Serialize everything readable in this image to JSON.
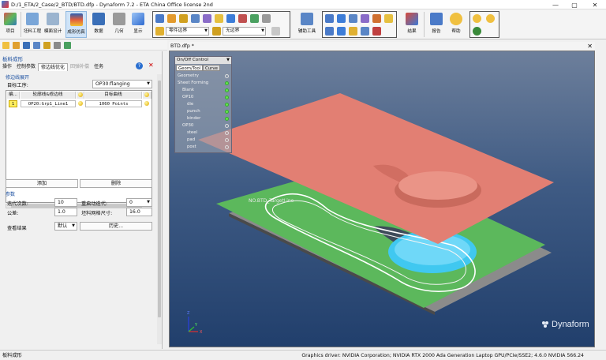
{
  "window": {
    "title": "D:/1_ETA/2_Case/2_BTD/BTD.dfp - Dynaform 7.2  -  ETA China Office license 2nd",
    "min": "—",
    "max": "▢",
    "close": "✕"
  },
  "ribbon": {
    "buttons": [
      {
        "label": "项目",
        "color": "#d9534f"
      },
      {
        "label": "坯料工程",
        "color": "#7aa6d8"
      },
      {
        "label": "模面设计",
        "color": "#9bb4cf"
      },
      {
        "label": "成形仿真",
        "color": "#e25c3c"
      },
      {
        "label": "数据",
        "color": "#3a6fb8"
      },
      {
        "label": "几何",
        "color": "#8a8a8a"
      },
      {
        "label": "显示",
        "color": "#3d7dd8"
      }
    ],
    "selects": [
      "零件边界",
      "无边界"
    ],
    "tools": [
      {
        "label": "辅助工具",
        "color": "#5a86c6"
      },
      {
        "label": "结果",
        "color": "#d84a3a"
      },
      {
        "label": "报告",
        "color": "#4a7ac8"
      },
      {
        "label": "帮助",
        "color": "#e0b030"
      }
    ]
  },
  "panel": {
    "title": "板料成形",
    "tabs": [
      {
        "label": "操作",
        "state": "normal"
      },
      {
        "label": "控制参数",
        "state": "normal"
      },
      {
        "label": "修边线优化",
        "state": "active"
      },
      {
        "label": "回弹补偿",
        "state": "disabled"
      },
      {
        "label": "任务",
        "state": "normal"
      }
    ],
    "help": "?",
    "close": "✕",
    "section1": "修边线展开",
    "target_label": "目标工序:",
    "target_value": "OP30:flanging",
    "table": {
      "headers": [
        "编...",
        "轮廓线&修边线",
        "",
        "目标曲线",
        ""
      ],
      "rows": [
        {
          "id": "1",
          "contour": "OP20:Grp1_Line1",
          "target": "1060 Points"
        }
      ]
    },
    "add": "添加",
    "delete": "删除",
    "section2": "参数",
    "iter_label": "迭代次数:",
    "iter_value": "10",
    "restart_label": "重启动迭代:",
    "restart_value": "0",
    "tol_label": "公差:",
    "tol_value": "1.0",
    "mesh_label": "坯料网格尺寸:",
    "mesh_value": "16.0",
    "view_label": "查看结果",
    "view_value": "默认",
    "history": "历史..."
  },
  "viewport": {
    "tab": "BTD.dfp *",
    "tab_close": "✕",
    "overlay_label": "NO.BTD_TargetLine",
    "brand": "Dynaform",
    "axis_x": "X",
    "axis_y": "Y",
    "axis_z": "Z",
    "tree": {
      "header": "On/Off Control",
      "tabs": [
        "Geom/Tool",
        "Curve"
      ],
      "nodes": [
        {
          "label": "Geometry",
          "indent": 0,
          "on": false
        },
        {
          "label": "Sheet Forming",
          "indent": 0,
          "on": true
        },
        {
          "label": "Blank",
          "indent": 1,
          "on": true
        },
        {
          "label": "OP10",
          "indent": 1,
          "on": true
        },
        {
          "label": "die",
          "indent": 2,
          "on": true
        },
        {
          "label": "punch",
          "indent": 2,
          "on": true
        },
        {
          "label": "binder",
          "indent": 2,
          "on": true
        },
        {
          "label": "OP30",
          "indent": 1,
          "on": false
        },
        {
          "label": "steel",
          "indent": 2,
          "on": false
        },
        {
          "label": "pad",
          "indent": 2,
          "on": false
        },
        {
          "label": "post",
          "indent": 2,
          "on": false
        }
      ]
    }
  },
  "status": {
    "left": "板料成形",
    "right": "Graphics driver: NVIDIA Corporation; NVIDIA RTX 2000 Ada Generation Laptop GPU/PCIe/SSE2; 4.6.0 NVIDIA 566.24"
  }
}
